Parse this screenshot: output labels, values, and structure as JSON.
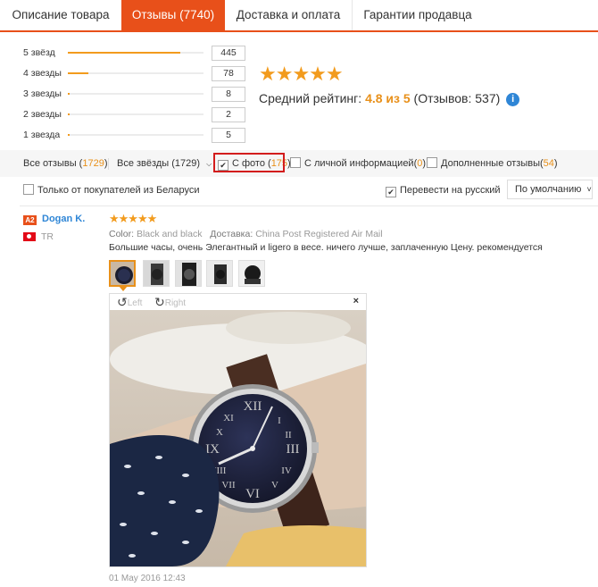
{
  "tabs": [
    {
      "label": "Описание товара"
    },
    {
      "label": "Отзывы (7740)"
    },
    {
      "label": "Доставка и оплата"
    },
    {
      "label": "Гарантии продавца"
    }
  ],
  "histogram": [
    {
      "label": "5 звёзд",
      "count": "445",
      "fraction": 0.83
    },
    {
      "label": "4 звезды",
      "count": "78",
      "fraction": 0.15
    },
    {
      "label": "3 звезды",
      "count": "8",
      "fraction": 0.015
    },
    {
      "label": "2 звезды",
      "count": "2",
      "fraction": 0.004
    },
    {
      "label": "1 звезда",
      "count": "5",
      "fraction": 0.01
    }
  ],
  "summary": {
    "stars": "★★★★★",
    "avg_prefix": "Средний рейтинг: ",
    "avg_value": "4.8 из 5",
    "avg_suffix": " (Отзывов: 537)",
    "info_icon": "i"
  },
  "filters": {
    "all_label": "Все отзывы (",
    "all_count": "1729",
    "all_close": ")",
    "stars_select": "Все звёзды (1729)",
    "photo_label": "С фото (",
    "photo_count": "175",
    "photo_close": ")",
    "personal_label": "С личной информацией(",
    "personal_count": "0",
    "personal_close": ")",
    "extra_label": "Дополненные отзывы(",
    "extra_count": "54",
    "extra_close": ")",
    "belarus_label": "Только от покупателей из Беларуси",
    "translate_label": "Перевести на русский",
    "sort_label": "По умолчанию"
  },
  "review": {
    "badge": "A2",
    "user": "Dogan K.",
    "country": "TR",
    "stars": "★★★★★",
    "color_label": "Color:",
    "color_value": "Black and black",
    "delivery_label": "Доставка:",
    "delivery_value": "China Post Registered Air Mail",
    "text": "Большие часы, очень Элегантный и ligero в весе. ничего лучше, заплаченную Цену. рекомендуется",
    "rotate_left": "Left",
    "rotate_right": "Right",
    "close": "×",
    "date": "01 May 2016 12:43"
  },
  "colors": {
    "accent": "#e8501a",
    "star": "#f29b1d",
    "link": "#2f86d6",
    "highlight": "#d31c1c"
  }
}
